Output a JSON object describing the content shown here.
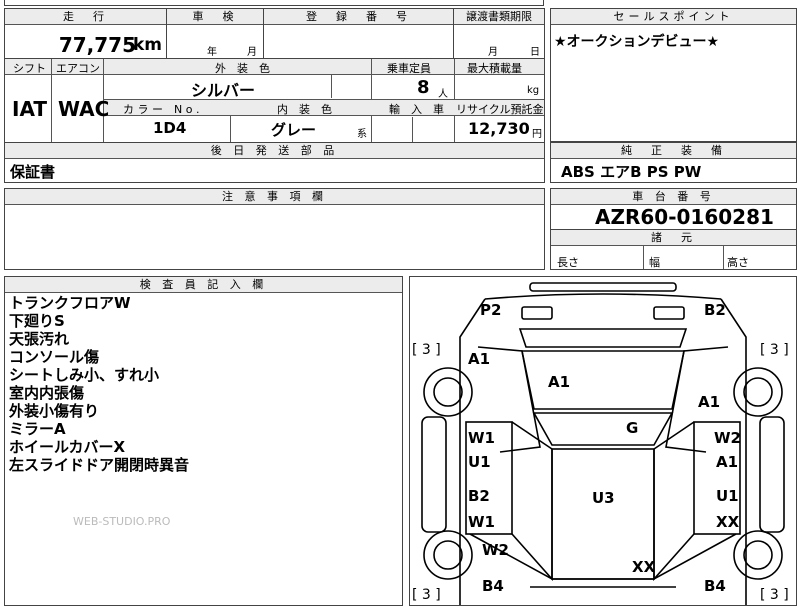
{
  "top": {
    "mileage_header": "走　行",
    "mileage_value": "77,775",
    "mileage_unit": "km",
    "inspection_header": "車　検",
    "inspection_year": "年",
    "inspection_month": "月",
    "registration_header": "登　録　番　号",
    "transfer_header": "譲渡書類期限",
    "transfer_month": "月",
    "transfer_day": "日",
    "sales_point_header": "セールスポイント",
    "sales_point_text": "★オークションデビュー★"
  },
  "row2": {
    "shift_header": "シフト",
    "aircon_header": "エアコン",
    "exterior_color_header": "外　装　色",
    "capacity_header": "乗車定員",
    "max_load_header": "最大積載量",
    "shift_value": "IAT",
    "aircon_value": "WAC",
    "exterior_color_value": "シルバー",
    "capacity_value": "8",
    "capacity_unit": "人",
    "max_load_unit": "kg",
    "color_no_header": "カ ラ ー　N o .",
    "interior_color_header": "内　装　色",
    "import_header": "輸　入　車",
    "recycle_header": "リサイクル預託金",
    "color_no_value": "1D4",
    "interior_color_value": "グレー",
    "interior_color_suffix": "系",
    "recycle_value": "12,730",
    "recycle_unit": "円"
  },
  "later_parts": {
    "header": "後 日 発 送 部 品",
    "value": "保証書"
  },
  "equipment": {
    "header": "純　正　装　備",
    "value": "ABS エアB PS PW"
  },
  "notes": {
    "header": "注 意 事 項 欄"
  },
  "chassis": {
    "header": "車 台 番 号",
    "value": "AZR60-0160281"
  },
  "dimensions": {
    "header": "諸　元",
    "length_label": "長さ",
    "width_label": "幅",
    "height_label": "高さ"
  },
  "inspector": {
    "header": "検 査 員 記 入 欄",
    "lines": [
      "トランクフロアW",
      "下廻りS",
      "天張汚れ",
      "コンソール傷",
      "シートしみ小、すれ小",
      "室内内張傷",
      "外装小傷有り",
      "ミラーA",
      "ホイールカバーX",
      "左スライドドア開閉時異音"
    ],
    "watermark": "WEB-STUDIO.PRO"
  },
  "diagram": {
    "labels": {
      "p2": "P2",
      "b2_top": "B2",
      "tire_fl": "[ 3 ]",
      "tire_fr": "[ 3 ]",
      "tire_rl": "[ 3 ]",
      "tire_rr": "[ 3 ]",
      "a1_left": "A1",
      "a1_center": "A1",
      "a1_right": "A1",
      "g": "G",
      "w1_left": "W1",
      "u1_left": "U1",
      "w2_right": "W2",
      "a1_right2": "A1",
      "u3": "U3",
      "b2_left": "B2",
      "w1_left2": "W1",
      "u1_right": "U1",
      "xx_right": "XX",
      "w2_left": "W2",
      "xx_bottom": "XX",
      "b4_left": "B4",
      "b4_right": "B4"
    }
  }
}
